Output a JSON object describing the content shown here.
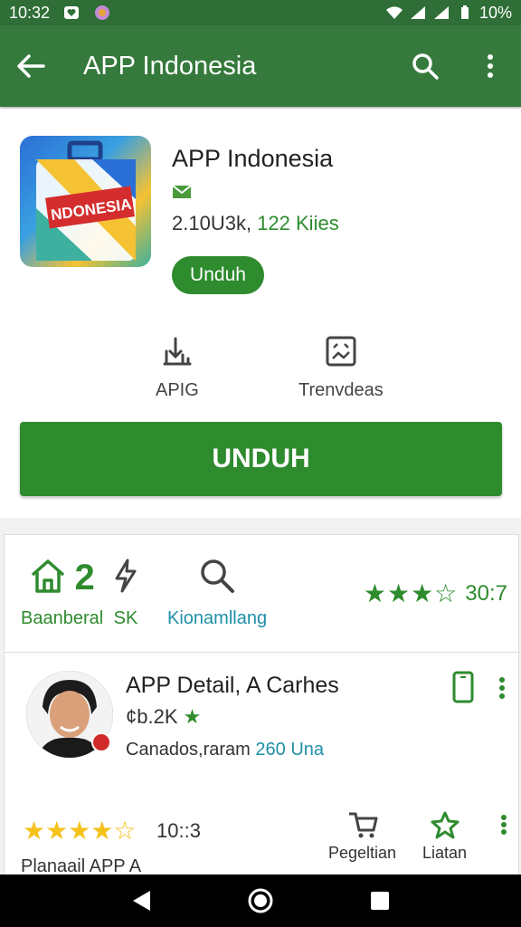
{
  "status_bar": {
    "time": "10:32",
    "battery": "10%"
  },
  "app_bar": {
    "title": "APP Indonesia",
    "icons": [
      "back-arrow-icon",
      "search-icon",
      "more-vert-icon"
    ]
  },
  "app_card": {
    "app_name": "APP Indonesia",
    "icon_text": "NDONESIA",
    "stats_left": "2.10U3k,",
    "stats_right": "122 Kiies",
    "unduh_pill": "Unduh",
    "actions": [
      {
        "label": "APIG",
        "icon": "download-chart-icon"
      },
      {
        "label": "Trenvdeas",
        "icon": "image-frame-icon"
      }
    ],
    "unduh_button": "UNDUH"
  },
  "stats_row": {
    "items": [
      {
        "icon": "home-icon",
        "value": "2",
        "label": "Baanberal"
      },
      {
        "icon": "lightning-icon",
        "value": "",
        "label": "SK"
      },
      {
        "icon": "search-zoom-icon",
        "value": "",
        "label": "Kionamllang"
      }
    ],
    "rating_stars": "★★★☆",
    "rating_value": "30:7"
  },
  "detail": {
    "title": "APP Detail, A Carhes",
    "sub_value": "¢b.2K",
    "sub_star": "★",
    "meta_text": "Canados,raram",
    "meta_blue": "260 Una"
  },
  "bottom": {
    "stars": "★★★★☆",
    "count": "10::3",
    "cut_text": "Planaail APP A",
    "actions": [
      {
        "label": "Pegeltian",
        "icon": "cart-icon"
      },
      {
        "label": "Liatan",
        "icon": "star-outline-icon"
      }
    ]
  },
  "colors": {
    "primary": "#357a3c",
    "accent_green": "#2e8b2e",
    "accent_blue": "#1f8fa8",
    "gold": "#f4c21a"
  }
}
